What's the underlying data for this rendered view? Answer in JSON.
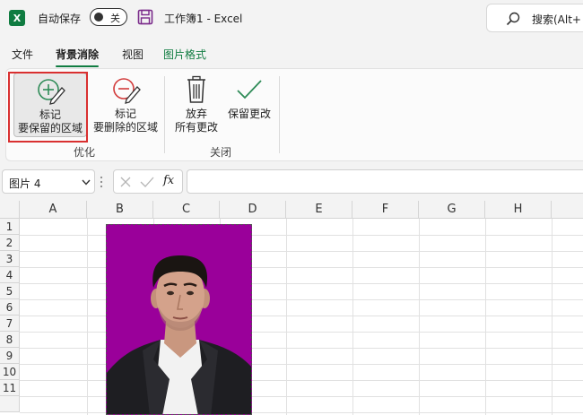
{
  "titlebar": {
    "app_badge": "X",
    "autosave_label": "自动保存",
    "autosave_state": "关",
    "doc_title": "工作簿1 - Excel",
    "search_text": "搜索(Alt+"
  },
  "tabs": [
    {
      "label": "文件"
    },
    {
      "label": "背景消除"
    },
    {
      "label": "视图"
    },
    {
      "label": "图片格式"
    }
  ],
  "ribbon": {
    "mark_keep": {
      "line1": "标记",
      "line2": "要保留的区域"
    },
    "mark_remove": {
      "line1": "标记",
      "line2": "要删除的区域"
    },
    "group_refine": "优化",
    "discard": {
      "line1": "放弃",
      "line2": "所有更改"
    },
    "keep_changes": {
      "line1": "保留更改"
    },
    "group_close": "关闭"
  },
  "formula_bar": {
    "name_box": "图片 4",
    "fx": "fx",
    "formula": ""
  },
  "grid": {
    "columns": [
      "A",
      "B",
      "C",
      "D",
      "E",
      "F",
      "G",
      "H"
    ],
    "rows": [
      "1",
      "2",
      "3",
      "4",
      "5",
      "6",
      "7",
      "8",
      "9",
      "10",
      "11"
    ]
  },
  "colors": {
    "accent": "#107c41",
    "picture_background": "#9a009a",
    "highlight": "#d93030"
  },
  "icons": [
    "excel-logo-icon",
    "save-icon",
    "search-icon",
    "pencil-plus-icon",
    "pencil-minus-icon",
    "trash-icon",
    "checkmark-icon",
    "chevron-down-icon",
    "close-icon",
    "fx-icon"
  ]
}
